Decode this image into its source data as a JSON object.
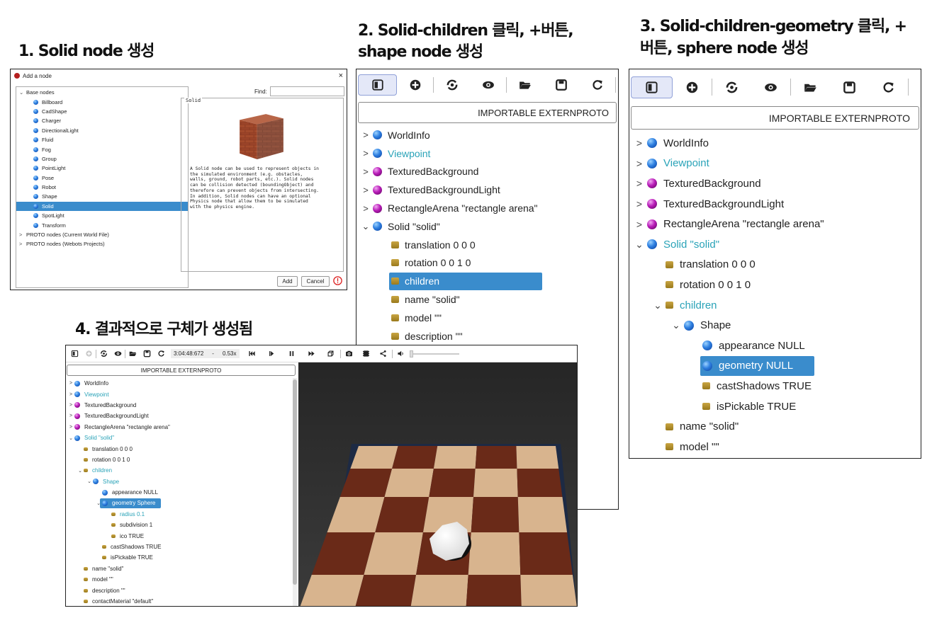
{
  "titles": {
    "step1": "1. Solid node 생성",
    "step2_line1": "2. Solid-children 클릭, +버튼,",
    "step2_line2": "shape node 생성",
    "step3_line1": "3. Solid-children-geometry 클릭, +",
    "step3_line2": "버튼, sphere node 생성",
    "step4": "4. 결과적으로 구체가 생성됨"
  },
  "dialog": {
    "title": "Add a node",
    "close": "×",
    "find_label": "Find:",
    "find_value": "",
    "group_label": "Solid",
    "tree": [
      {
        "label": "Base nodes",
        "level": 0,
        "toggle": "⌄"
      },
      {
        "label": "Billboard",
        "level": 1
      },
      {
        "label": "CadShape",
        "level": 1
      },
      {
        "label": "Charger",
        "level": 1
      },
      {
        "label": "DirectionalLight",
        "level": 1
      },
      {
        "label": "Fluid",
        "level": 1
      },
      {
        "label": "Fog",
        "level": 1
      },
      {
        "label": "Group",
        "level": 1
      },
      {
        "label": "PointLight",
        "level": 1
      },
      {
        "label": "Pose",
        "level": 1
      },
      {
        "label": "Robot",
        "level": 1
      },
      {
        "label": "Shape",
        "level": 1
      },
      {
        "label": "Solid",
        "level": 1,
        "selected": true
      },
      {
        "label": "SpotLight",
        "level": 1
      },
      {
        "label": "Transform",
        "level": 1
      },
      {
        "label": "PROTO nodes (Current World File)",
        "level": 0,
        "toggle": ">"
      },
      {
        "label": "PROTO nodes (Webots Projects)",
        "level": 0,
        "toggle": ">"
      }
    ],
    "description": "A Solid node can be used to represent objects in\nthe simulated environment (e.g. obstacles,\nwalls, ground, robot parts, etc.). Solid nodes\ncan be collision detected (boundingObject) and\ntherefore can prevent objects from intersecting.\nIn addition, Solid nodes can have an optional\nPhysics node that allow them to be simulated\nwith the physics engine.",
    "add_button": "Add",
    "cancel_button": "Cancel"
  },
  "importable": "IMPORTABLE EXTERNPROTO",
  "panel2_tree": [
    {
      "toggle": ">",
      "icon": "blue",
      "label": "WorldInfo"
    },
    {
      "toggle": ">",
      "icon": "blue",
      "label": "Viewpoint",
      "cyan": true
    },
    {
      "toggle": ">",
      "icon": "purple",
      "label": "TexturedBackground"
    },
    {
      "toggle": ">",
      "icon": "purple",
      "label": "TexturedBackgroundLight"
    },
    {
      "toggle": ">",
      "icon": "purple",
      "label": "RectangleArena \"rectangle arena\""
    },
    {
      "toggle": "⌄",
      "icon": "blue",
      "label": "Solid \"solid\""
    },
    {
      "toggle": "",
      "icon": "field",
      "label": "translation 0 0 0",
      "indent": 1
    },
    {
      "toggle": "",
      "icon": "field",
      "label": "rotation 0 0 1 0",
      "indent": 1
    },
    {
      "toggle": "",
      "icon": "field",
      "label": "children",
      "indent": 1,
      "selected": true
    },
    {
      "toggle": "",
      "icon": "field",
      "label": "name \"solid\"",
      "indent": 1
    },
    {
      "toggle": "",
      "icon": "field",
      "label": "model \"\"",
      "indent": 1
    },
    {
      "toggle": "",
      "icon": "field",
      "label": "description \"\"",
      "indent": 1
    }
  ],
  "panel3_tree": [
    {
      "toggle": ">",
      "icon": "blue",
      "label": "WorldInfo"
    },
    {
      "toggle": ">",
      "icon": "blue",
      "label": "Viewpoint",
      "cyan": true
    },
    {
      "toggle": ">",
      "icon": "purple",
      "label": "TexturedBackground"
    },
    {
      "toggle": ">",
      "icon": "purple",
      "label": "TexturedBackgroundLight"
    },
    {
      "toggle": ">",
      "icon": "purple",
      "label": "RectangleArena \"rectangle arena\""
    },
    {
      "toggle": "⌄",
      "icon": "blue",
      "label": "Solid \"solid\"",
      "cyan": true
    },
    {
      "toggle": "",
      "icon": "field",
      "label": "translation 0 0 0",
      "indent": 1
    },
    {
      "toggle": "",
      "icon": "field",
      "label": "rotation 0 0 1 0",
      "indent": 1
    },
    {
      "toggle": "⌄",
      "icon": "field",
      "label": "children",
      "indent": 1,
      "cyan": true
    },
    {
      "toggle": "⌄",
      "icon": "blue",
      "label": "Shape",
      "indent": 2
    },
    {
      "toggle": "",
      "icon": "blue",
      "label": "appearance NULL",
      "indent": 3
    },
    {
      "toggle": "",
      "icon": "blue",
      "label": "geometry NULL",
      "indent": 3,
      "selected": true
    },
    {
      "toggle": "",
      "icon": "field",
      "label": "castShadows TRUE",
      "indent": 3
    },
    {
      "toggle": "",
      "icon": "field",
      "label": "isPickable TRUE",
      "indent": 3
    },
    {
      "toggle": "",
      "icon": "field",
      "label": "name \"solid\"",
      "indent": 1
    },
    {
      "toggle": "",
      "icon": "field",
      "label": "model \"\"",
      "indent": 1
    }
  ],
  "panel4_toolbar": {
    "time": "3:04:48:672",
    "dash": "-",
    "speed": "0.53x"
  },
  "panel4_tree": [
    {
      "toggle": ">",
      "icon": "blue",
      "label": "WorldInfo"
    },
    {
      "toggle": ">",
      "icon": "blue",
      "label": "Viewpoint",
      "cyan": true
    },
    {
      "toggle": ">",
      "icon": "purple",
      "label": "TexturedBackground"
    },
    {
      "toggle": ">",
      "icon": "purple",
      "label": "TexturedBackgroundLight"
    },
    {
      "toggle": ">",
      "icon": "purple",
      "label": "RectangleArena \"rectangle arena\""
    },
    {
      "toggle": "⌄",
      "icon": "blue",
      "label": "Solid \"solid\"",
      "cyan": true
    },
    {
      "toggle": "",
      "icon": "field",
      "label": "translation 0 0 0",
      "indent": 1
    },
    {
      "toggle": "",
      "icon": "field",
      "label": "rotation 0 0 1 0",
      "indent": 1
    },
    {
      "toggle": "⌄",
      "icon": "field",
      "label": "children",
      "indent": 1,
      "cyan": true
    },
    {
      "toggle": "⌄",
      "icon": "blue",
      "label": "Shape",
      "indent": 2,
      "cyan": true
    },
    {
      "toggle": "",
      "icon": "blue",
      "label": "appearance NULL",
      "indent": 3
    },
    {
      "toggle": "⌄",
      "icon": "blue",
      "label": "geometry Sphere",
      "indent": 3,
      "selected": true
    },
    {
      "toggle": "",
      "icon": "field",
      "label": "radius 0.1",
      "indent": 4,
      "cyan": true
    },
    {
      "toggle": "",
      "icon": "field",
      "label": "subdivision 1",
      "indent": 4
    },
    {
      "toggle": "",
      "icon": "field",
      "label": "ico TRUE",
      "indent": 4
    },
    {
      "toggle": "",
      "icon": "field",
      "label": "castShadows TRUE",
      "indent": 3
    },
    {
      "toggle": "",
      "icon": "field",
      "label": "isPickable TRUE",
      "indent": 3
    },
    {
      "toggle": "",
      "icon": "field",
      "label": "name \"solid\"",
      "indent": 1
    },
    {
      "toggle": "",
      "icon": "field",
      "label": "model \"\"",
      "indent": 1
    },
    {
      "toggle": "",
      "icon": "field",
      "label": "description \"\"",
      "indent": 1
    },
    {
      "toggle": "",
      "icon": "field",
      "label": "contactMaterial \"default\"",
      "indent": 1
    }
  ],
  "colors": {
    "selection": "#3a8ccc",
    "cyan_text": "#2aa3b8",
    "node_blue": "#2e7fe0",
    "node_purple": "#b81cb8",
    "field_gold": "#b08a26"
  }
}
